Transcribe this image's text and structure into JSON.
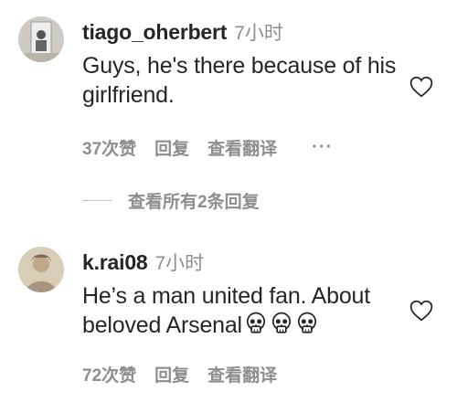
{
  "comments": [
    {
      "username": "tiago_oherbert",
      "time": "7小时",
      "text": "Guys, he's there because of his girlfriend.",
      "likes": "37次赞",
      "reply": "回复",
      "translate": "查看翻译",
      "more": "···",
      "reply_thread": "查看所有2条回复",
      "icons": {
        "like": "heart-outline-icon",
        "more": "more-options-icon"
      }
    },
    {
      "username": "k.rai08",
      "time": "7小时",
      "text": "He’s a man united fan. About beloved Arsenal",
      "emoji": [
        "💀",
        "💀",
        "💀"
      ],
      "likes": "72次赞",
      "reply": "回复",
      "translate": "查看翻译",
      "icons": {
        "like": "heart-outline-icon"
      }
    }
  ],
  "colors": {
    "primary_text": "#262626",
    "secondary_text": "#8e8e8e",
    "divider": "#c7c7c7"
  }
}
